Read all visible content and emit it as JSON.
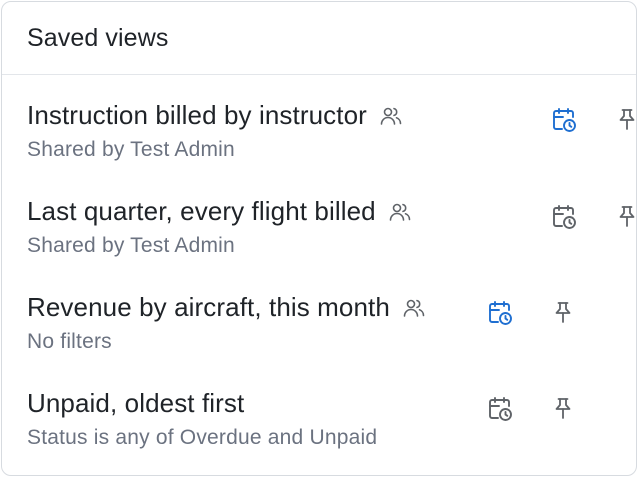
{
  "panel": {
    "title": "Saved views"
  },
  "views": [
    {
      "title": "Instruction billed by instructor",
      "subtitle": "Shared by Test Admin",
      "shared": true,
      "schedule_active": true,
      "schedule_icon": "calendar-clock-icon",
      "pin_icon": "pin-icon",
      "shared_icon": "users-icon"
    },
    {
      "title": "Last quarter, every flight billed",
      "subtitle": "Shared by Test Admin",
      "shared": true,
      "schedule_active": false,
      "schedule_icon": "calendar-clock-icon",
      "pin_icon": "pin-icon",
      "shared_icon": "users-icon"
    },
    {
      "title": "Revenue by aircraft, this month",
      "subtitle": "No filters",
      "shared": true,
      "schedule_active": true,
      "schedule_icon": "calendar-clock-icon",
      "pin_icon": "pin-icon",
      "shared_icon": "users-icon"
    },
    {
      "title": "Unpaid, oldest first",
      "subtitle": "Status is any of Overdue and Unpaid",
      "shared": false,
      "schedule_active": false,
      "schedule_icon": "calendar-clock-icon",
      "pin_icon": "pin-icon"
    }
  ],
  "colors": {
    "accent_blue": "#1f6fd1",
    "icon_gray": "#5f6368",
    "text_primary": "#1f2328",
    "text_secondary": "#6b7280"
  }
}
